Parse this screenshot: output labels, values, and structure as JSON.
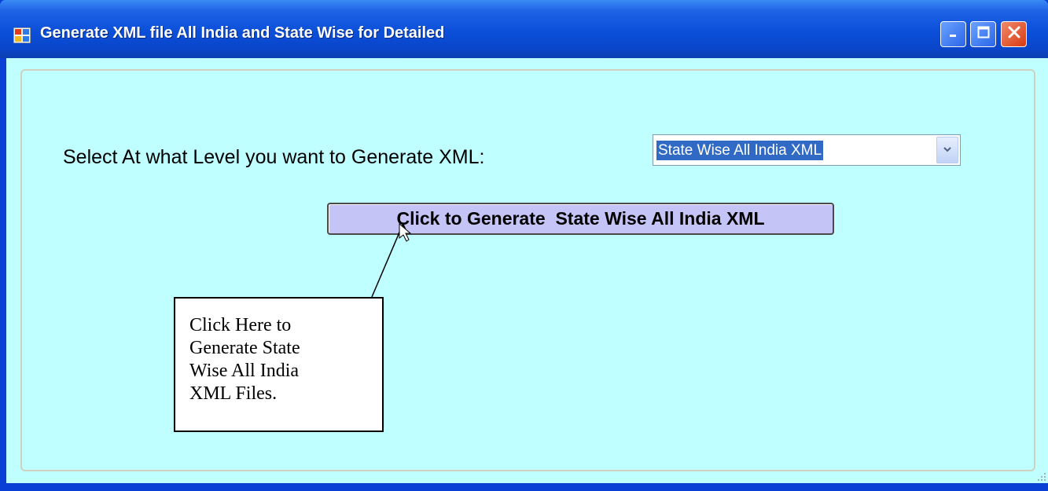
{
  "window": {
    "title": "Generate XML file All India and State Wise for Detailed",
    "colors": {
      "titlebar": "#0b4fd9",
      "client_background": "#bfffff",
      "button_face": "#c5c4f7",
      "selection": "#316ac5"
    }
  },
  "form": {
    "prompt_label": "Select At what Level you want to Generate XML:",
    "level_select": {
      "selected_value": "State Wise All India XML"
    },
    "generate_button_label": "Click to Generate  State Wise All India XML"
  },
  "annotation": {
    "text": "Click Here to\nGenerate State\nWise All India\nXML Files."
  },
  "icons": [
    "app-icon",
    "minimize-icon",
    "maximize-icon",
    "close-icon",
    "chevron-down-icon",
    "resize-grip-icon"
  ]
}
